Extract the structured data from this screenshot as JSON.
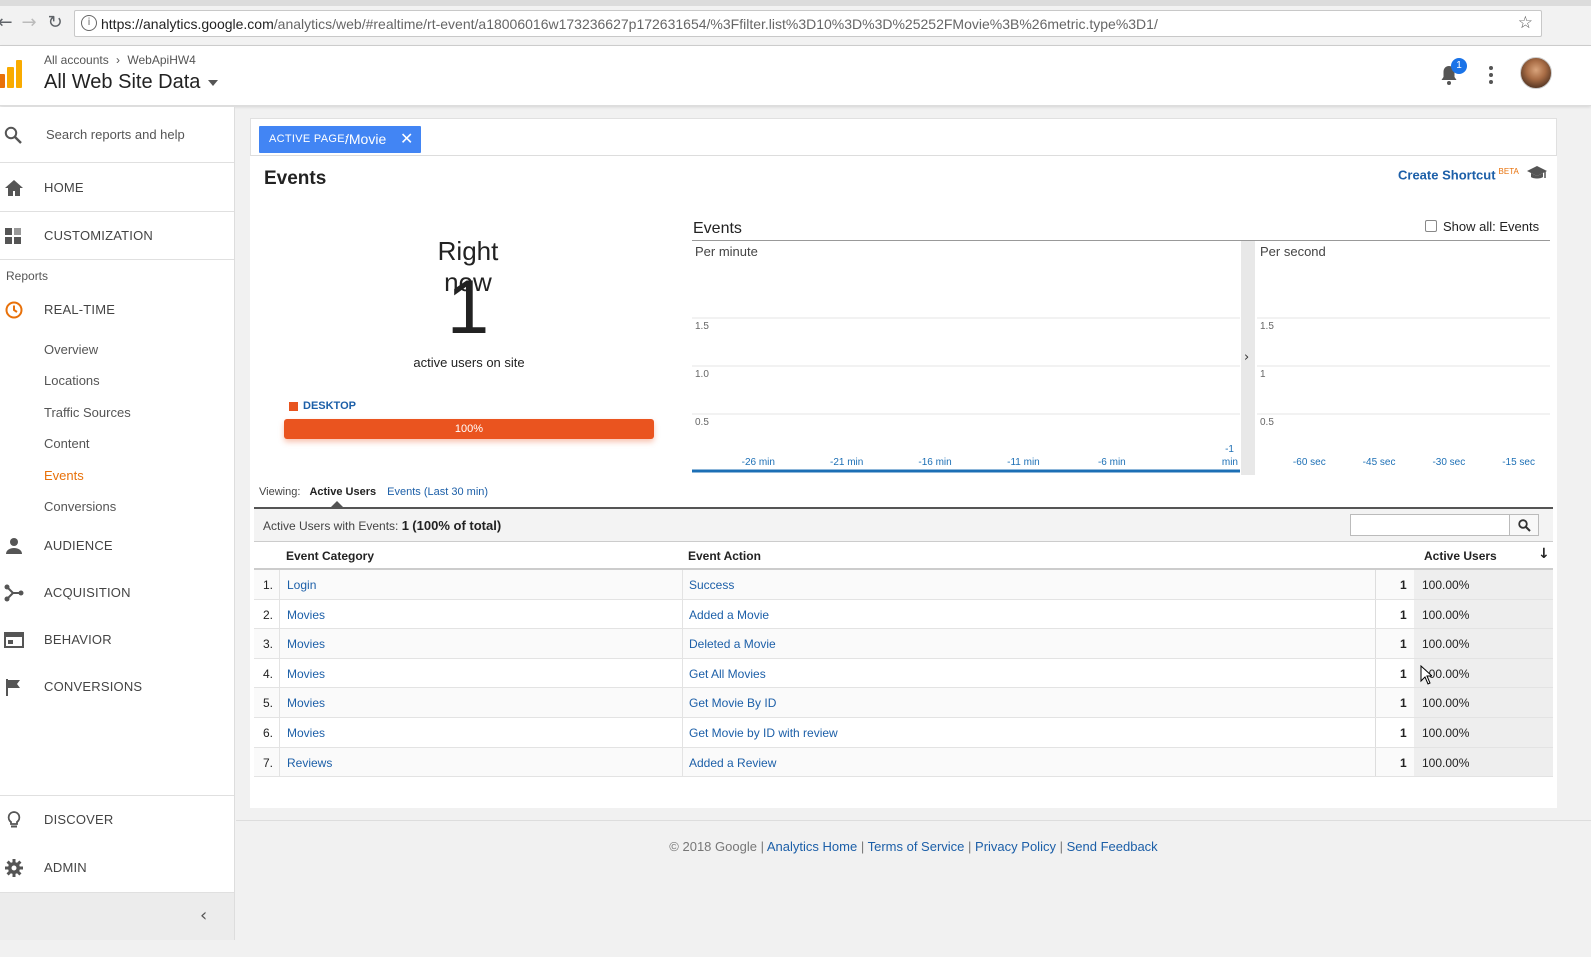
{
  "browser": {
    "url_host": "https://analytics.google.com",
    "url_path": "/analytics/web/#realtime/rt-event/a18006016w173236627p172631654/%3Ffilter.list%3D10%3D%3D%25252FMovie%3B%26metric.type%3D1/"
  },
  "header": {
    "breadcrumb_root": "All accounts",
    "breadcrumb_sep": "›",
    "breadcrumb_property": "WebApiHW4",
    "view_title": "All Web Site Data",
    "notification_count": "1"
  },
  "sidebar": {
    "search_placeholder": "Search reports and help",
    "home": "HOME",
    "customization": "CUSTOMIZATION",
    "reports_label": "Reports",
    "realtime": "REAL-TIME",
    "realtime_items": [
      "Overview",
      "Locations",
      "Traffic Sources",
      "Content",
      "Events",
      "Conversions"
    ],
    "active_item": "Events",
    "audience": "AUDIENCE",
    "acquisition": "ACQUISITION",
    "behavior": "BEHAVIOR",
    "conversions": "CONVERSIONS",
    "discover": "DISCOVER",
    "admin": "ADMIN"
  },
  "filter": {
    "key": "ACTIVE PAGE:",
    "value": "/Movie"
  },
  "page": {
    "title": "Events",
    "shortcut": "Create Shortcut",
    "shortcut_badge": "BETA"
  },
  "right_now": {
    "label": "Right now",
    "count": "1",
    "sub": "active users on site",
    "device_label": "DESKTOP",
    "device_pct_label": "100%",
    "device_fraction": 1.0,
    "device_color": "#ea541f"
  },
  "charts_header": {
    "title": "Events",
    "show_all": "Show all: Events"
  },
  "chart_data": [
    {
      "type": "bar",
      "title": "Per minute",
      "y_ticks": [
        "1.5",
        "1.0",
        "0.5"
      ],
      "ylim": [
        0,
        2
      ],
      "x_ticks": [
        "-26 min",
        "-21 min",
        "-16 min",
        "-11 min",
        "-6 min",
        "-1 min"
      ],
      "values": [
        0,
        0,
        0,
        0,
        0,
        0
      ],
      "grid": true
    },
    {
      "type": "bar",
      "title": "Per second",
      "y_ticks": [
        "1.5",
        "1",
        "0.5"
      ],
      "ylim": [
        0,
        2
      ],
      "x_ticks": [
        "-60 sec",
        "-45 sec",
        "-30 sec",
        "-15 sec"
      ],
      "values": [
        0,
        0,
        0,
        0
      ],
      "grid": true
    }
  ],
  "viewing": {
    "label": "Viewing:",
    "active": "Active Users",
    "other": "Events (Last 30 min)"
  },
  "summary": {
    "prefix": "Active Users with Events:",
    "value": "1",
    "pct_open": "(",
    "pct": "100%",
    "pct_close": " of total)"
  },
  "table": {
    "headers": [
      "Event Category",
      "Event Action",
      "Active Users"
    ],
    "rows": [
      {
        "idx": "1.",
        "category": "Login",
        "action": "Success",
        "count": "1",
        "pct": "100.00%"
      },
      {
        "idx": "2.",
        "category": "Movies",
        "action": "Added a Movie",
        "count": "1",
        "pct": "100.00%"
      },
      {
        "idx": "3.",
        "category": "Movies",
        "action": "Deleted a Movie",
        "count": "1",
        "pct": "100.00%"
      },
      {
        "idx": "4.",
        "category": "Movies",
        "action": "Get All Movies",
        "count": "1",
        "pct": "100.00%"
      },
      {
        "idx": "5.",
        "category": "Movies",
        "action": "Get Movie By ID",
        "count": "1",
        "pct": "100.00%"
      },
      {
        "idx": "6.",
        "category": "Movies",
        "action": "Get Movie by ID with review",
        "count": "1",
        "pct": "100.00%"
      },
      {
        "idx": "7.",
        "category": "Reviews",
        "action": "Added a Review",
        "count": "1",
        "pct": "100.00%"
      }
    ]
  },
  "footer": {
    "copyright": "© 2018 Google",
    "sep": "|",
    "links": [
      "Analytics Home",
      "Terms of Service",
      "Privacy Policy",
      "Send Feedback"
    ]
  },
  "colors": {
    "accent_orange": "#e8710a",
    "link_blue": "#1c5fa8",
    "chip_blue": "#4285f4"
  }
}
